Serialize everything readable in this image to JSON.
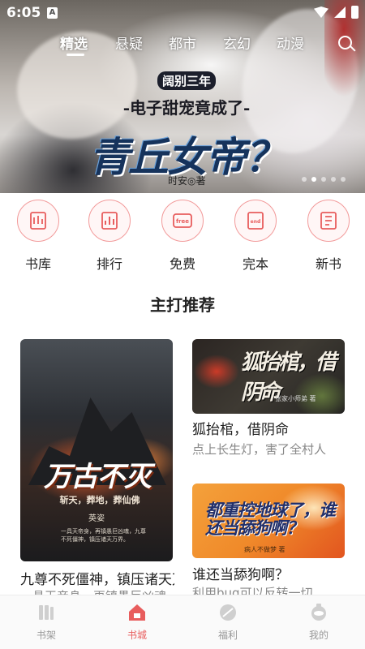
{
  "status_bar": {
    "time": "6:05",
    "indicator": "A"
  },
  "top_tabs": [
    {
      "label": "精选",
      "active": true
    },
    {
      "label": "悬疑",
      "active": false
    },
    {
      "label": "都市",
      "active": false
    },
    {
      "label": "玄幻",
      "active": false
    },
    {
      "label": "动漫",
      "active": false
    }
  ],
  "search_icon": "search-icon",
  "banner": {
    "kicker": "阔别三年",
    "subtitle": "-电子甜宠竟成了-",
    "title": "青丘女帝？",
    "author": "时安◎著",
    "dot_count": 5,
    "active_dot": 1
  },
  "quick_nav": [
    {
      "label": "书库",
      "icon": "library-icon"
    },
    {
      "label": "排行",
      "icon": "ranking-icon"
    },
    {
      "label": "免费",
      "icon": "free-icon"
    },
    {
      "label": "完本",
      "icon": "completed-icon"
    },
    {
      "label": "新书",
      "icon": "new-book-icon"
    }
  ],
  "section": {
    "title": "主打推荐",
    "main_book": {
      "cover_title": "万古不灭",
      "cover_tagline": "斩天，葬地，葬仙佛",
      "cover_author": "英姿",
      "cover_blurb": "一具天帝身，再镇愚巨凶魂，九尊不死僵神，镇压诸天万界。",
      "name": "九尊不死僵神，镇压诸天万界",
      "desc": "一具天帝身，再镇愚巨凶魂"
    },
    "side_books": [
      {
        "cover_title": "狐抬棺，借阴命",
        "cover_author": "张家小师弟 著",
        "name": "狐抬棺，借阴命",
        "desc": "点上长生灯，害了全村人"
      },
      {
        "cover_title": "都重控地球了，谁还当舔狗啊？",
        "cover_author": "病人不做梦 著",
        "name": "谁还当舔狗啊？",
        "desc": "利用bug可以反转一切"
      }
    ]
  },
  "bottom_nav": [
    {
      "label": "书架",
      "icon": "bookshelf-icon",
      "active": false
    },
    {
      "label": "书城",
      "icon": "bookstore-icon",
      "active": true
    },
    {
      "label": "福利",
      "icon": "welfare-icon",
      "active": false
    },
    {
      "label": "我的",
      "icon": "profile-icon",
      "active": false
    }
  ],
  "colors": {
    "accent": "#e85d5d",
    "quick_icon_border": "#f29a9a",
    "inactive_nav": "#999999"
  }
}
